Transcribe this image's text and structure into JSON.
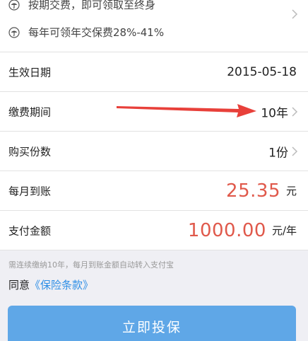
{
  "features": [
    {
      "icon": "umbrella-icon",
      "text": "按期交费，即可领取至终身"
    },
    {
      "icon": "umbrella-icon",
      "text": "每年可领年交保费28%-41%"
    }
  ],
  "rows": {
    "effective_date": {
      "label": "生效日期",
      "value": "2015-05-18"
    },
    "payment_period": {
      "label": "缴费期间",
      "value": "10年"
    },
    "purchase_count": {
      "label": "购买份数",
      "value": "1份"
    },
    "monthly_payout": {
      "label": "每月到账",
      "amount": "25.35",
      "unit": "元"
    },
    "payment_amount": {
      "label": "支付金额",
      "amount": "1000.00",
      "unit": "元/年"
    }
  },
  "notice": "需连续缴纳10年，每月到账金额自动转入支付宝",
  "agree": {
    "prefix": "同意",
    "link": "《保险条款》"
  },
  "submit_label": "立即投保",
  "colors": {
    "accent": "#e0594b",
    "link": "#2f8fe6",
    "button": "#5fa7e7",
    "arrow": "#e8403a"
  }
}
